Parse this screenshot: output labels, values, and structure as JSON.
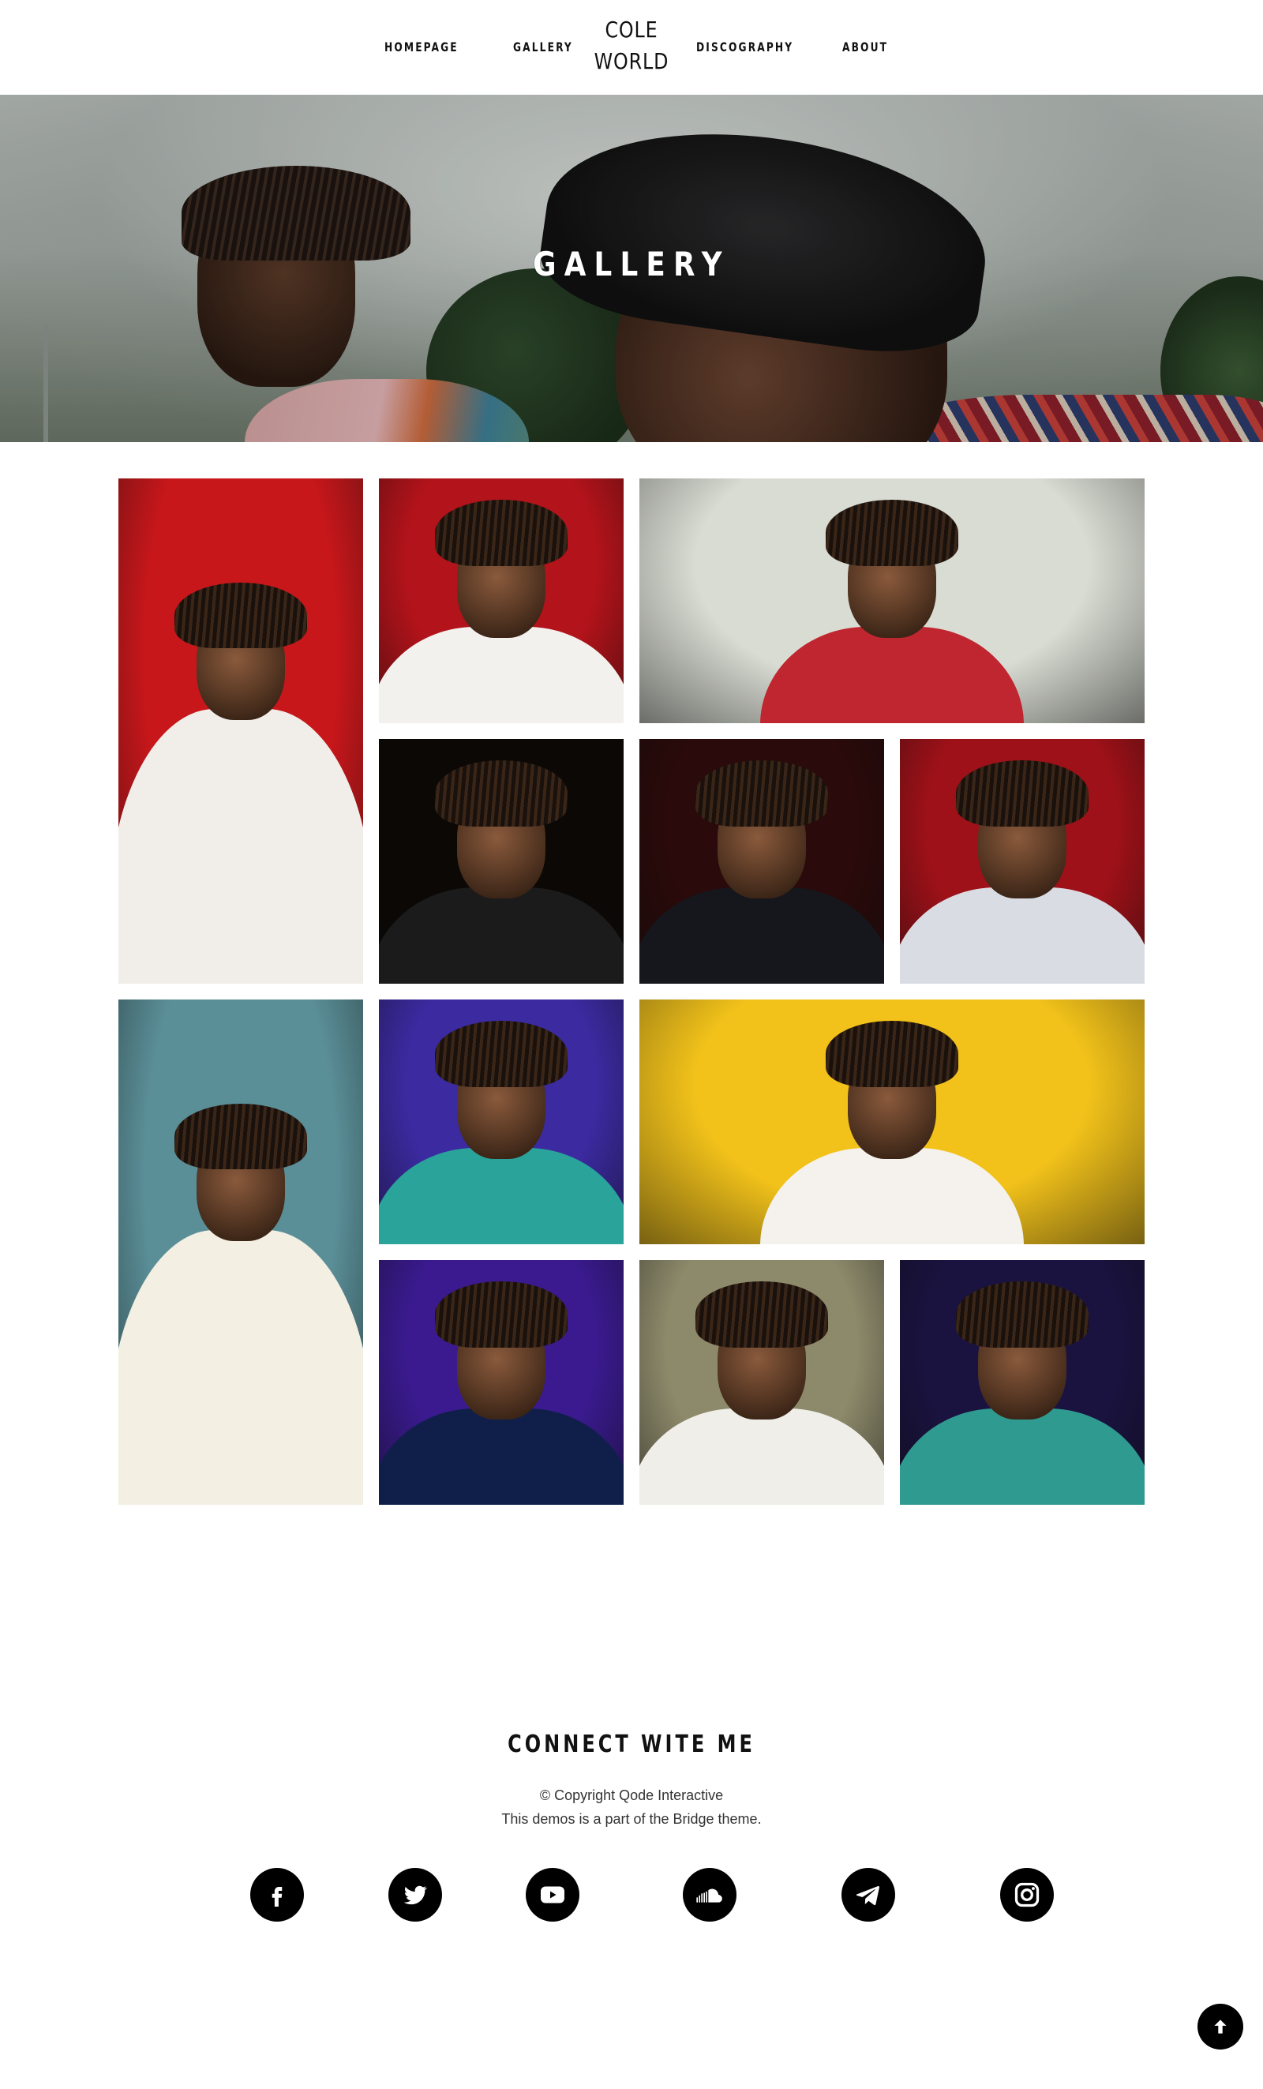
{
  "nav": {
    "items": [
      "HOMEPAGE",
      "GALLERY",
      "DISCOGRAPHY",
      "ABOUT"
    ],
    "logo_line1": "COLE",
    "logo_line2": "WORLD"
  },
  "hero": {
    "title": "GALLERY"
  },
  "gallery": {
    "photos": [
      {
        "name": "photo-red-stage-portrait",
        "bg": "#c8171b",
        "shirt": "#f1eeea"
      },
      {
        "name": "photo-red-eyes-closed",
        "bg": "#b3131a",
        "shirt": "#f3f1ee"
      },
      {
        "name": "photo-supermarket-aisle",
        "bg": "#d9dcd3",
        "shirt": "#c0262f"
      },
      {
        "name": "photo-sitting-dark-stage",
        "bg": "#0b0805",
        "shirt": "#1b1b1b"
      },
      {
        "name": "photo-dreamville-hoodie",
        "bg": "#2a0a0a",
        "shirt": "#15171c"
      },
      {
        "name": "photo-red-smoke-stage",
        "bg": "#9e1118",
        "shirt": "#d9dde3"
      },
      {
        "name": "photo-festival-arm-raised",
        "bg": "#5b8f98",
        "shirt": "#f3efe2"
      },
      {
        "name": "photo-purple-hornets-jersey",
        "bg": "#3b2aa0",
        "shirt": "#2aa39a"
      },
      {
        "name": "photo-yellow-bulls-jersey",
        "bg": "#f2c21a",
        "shirt": "#f5f2ee"
      },
      {
        "name": "photo-mic-closeup-purple",
        "bg": "#3a1a8e",
        "shirt": "#0f1f4a"
      },
      {
        "name": "photo-garden-path",
        "bg": "#8d8a6b",
        "shirt": "#efeee9"
      },
      {
        "name": "photo-teal-tracksuit",
        "bg": "#1a1340",
        "shirt": "#2f9a8f"
      }
    ]
  },
  "footer": {
    "title": "CONNECT WITE ME",
    "copyright": "©  Copyright Qode Interactive",
    "note": "This demos is a part of the Bridge theme.",
    "social": [
      "facebook-icon",
      "twitter-icon",
      "youtube-icon",
      "soundcloud-icon",
      "telegram-icon",
      "instagram-icon"
    ]
  }
}
